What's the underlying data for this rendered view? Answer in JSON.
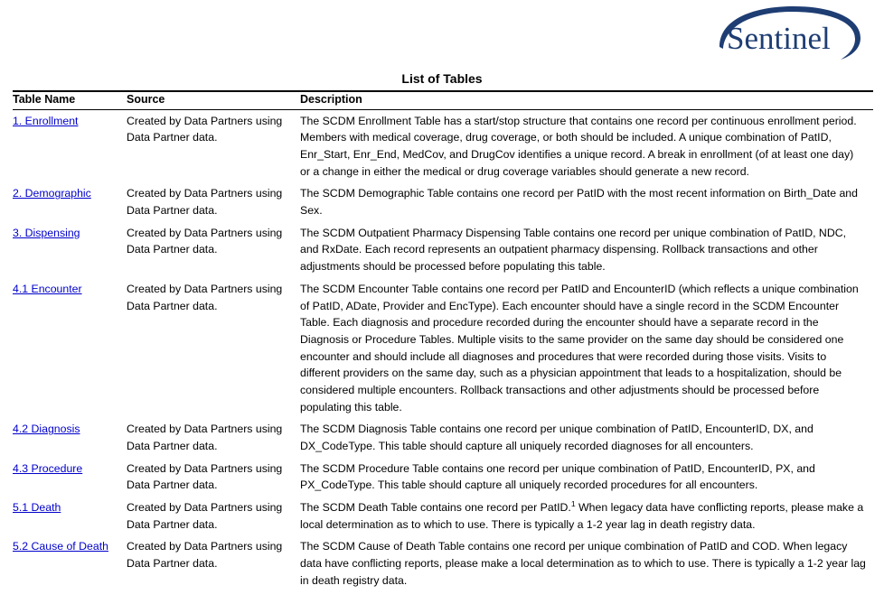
{
  "logo": {
    "brand": "Sentinel",
    "swoosh_color": "#1e3d73",
    "text_color": "#1e3d73"
  },
  "document": {
    "title": "List of Tables",
    "link_color": "#0000cc"
  },
  "table": {
    "headers": {
      "name": "Table Name",
      "source": "Source",
      "description": "Description"
    },
    "rows": [
      {
        "name": "1. Enrollment",
        "source": "Created by Data Partners using Data Partner data.",
        "description": "The SCDM Enrollment Table has a start/stop structure that contains one record per continuous enrollment period. Members with medical coverage, drug coverage, or both should be included. A unique combination of PatID, Enr_Start, Enr_End, MedCov, and DrugCov identifies a unique record. A break in enrollment (of at least one day) or a change in either the medical or drug coverage variables should generate a new record."
      },
      {
        "name": "2. Demographic",
        "source": "Created by Data Partners using Data Partner data.",
        "description": "The SCDM Demographic Table contains one record per PatID with the most recent information on Birth_Date and Sex."
      },
      {
        "name": "3. Dispensing",
        "source": "Created by Data Partners using Data Partner data.",
        "description": "The SCDM Outpatient Pharmacy Dispensing Table contains one record per unique combination of PatID, NDC, and RxDate. Each record represents an outpatient pharmacy dispensing. Rollback transactions and other adjustments should be processed before populating this table."
      },
      {
        "name": "4.1 Encounter",
        "source": "Created by Data Partners using Data Partner data.",
        "description": "The SCDM Encounter Table contains one record per PatID and EncounterID (which reflects a unique combination of PatID, ADate, Provider and EncType). Each encounter should have a single record in the SCDM Encounter Table. Each diagnosis and procedure recorded during the encounter should have a separate record in the Diagnosis or Procedure Tables. Multiple visits to the same provider on the same day should be considered one encounter and should include all diagnoses and procedures that were recorded during those visits. Visits to different providers on the same day, such as a physician appointment that leads to a hospitalization, should be considered multiple encounters. Rollback transactions and other adjustments should be processed before populating this table."
      },
      {
        "name": "4.2 Diagnosis",
        "source": "Created by Data Partners using Data Partner data.",
        "description": "The SCDM Diagnosis Table contains one record per unique combination of PatID, EncounterID, DX, and DX_CodeType. This table should capture all uniquely recorded diagnoses for all encounters."
      },
      {
        "name": "4.3 Procedure",
        "source": "Created by Data Partners using Data Partner data.",
        "description": "The SCDM Procedure Table contains one record per unique combination of PatID, EncounterID, PX, and PX_CodeType. This table should capture all uniquely recorded procedures for all encounters."
      },
      {
        "name": "5.1 Death",
        "source": "Created by Data Partners using Data Partner data.",
        "description_before_footnote": "The SCDM Death Table contains one record per PatID.",
        "footnote_marker": "1",
        "description_after_footnote": " When legacy data have conflicting reports, please make a local determination as to which to use. There is typically a 1-2 year lag in death registry data."
      },
      {
        "name": "5.2 Cause of Death",
        "source": "Created by Data Partners using Data Partner data.",
        "description": "The SCDM Cause of Death Table contains one record per unique combination of PatID and COD. When legacy data have conflicting reports, please make a local determination as to which to use. There is typically a 1-2 year lag in death registry data."
      }
    ]
  }
}
